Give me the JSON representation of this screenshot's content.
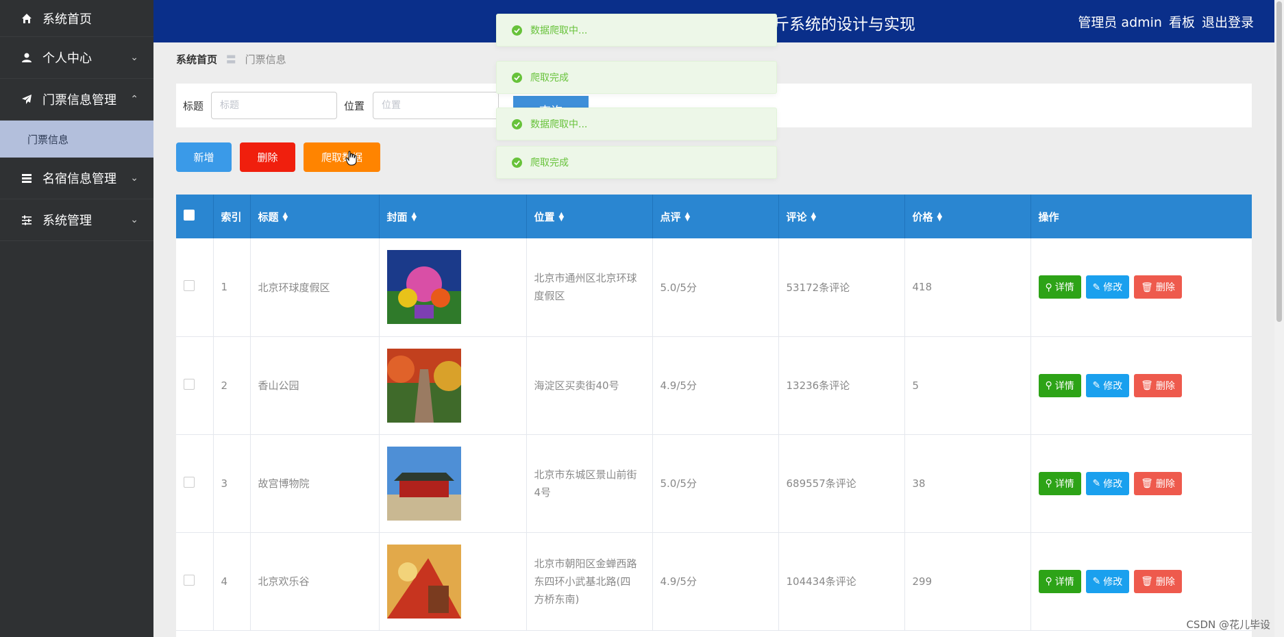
{
  "sidebar": {
    "items": [
      {
        "label": "系统首页",
        "icon": "home-icon"
      },
      {
        "label": "个人中心",
        "icon": "user-icon"
      },
      {
        "label": "门票信息管理",
        "icon": "paper-plane-icon"
      },
      {
        "label": "名宿信息管理",
        "icon": "list-icon"
      },
      {
        "label": "系统管理",
        "icon": "sliders-icon"
      }
    ],
    "submenu": {
      "label": "门票信息"
    }
  },
  "header": {
    "title": "斤系统的设计与实现",
    "user": "管理员 admin",
    "dashboard": "看板",
    "logout": "退出登录"
  },
  "breadcrumb": {
    "home": "系统首页",
    "separator": "〓",
    "current": "门票信息"
  },
  "search": {
    "title_label": "标题",
    "title_placeholder": "标题",
    "location_label": "位置",
    "location_placeholder": "位置",
    "query_label": "查询"
  },
  "actions": {
    "add": "新增",
    "delete": "删除",
    "crawl": "爬取数据"
  },
  "colors": {
    "add": "#3a9ae8",
    "delete": "#f01f0d",
    "crawl": "#ff8400",
    "header": "#0a2f8a",
    "table_header": "#2a86d1"
  },
  "table": {
    "headers": {
      "index": "索引",
      "title": "标题",
      "cover": "封面",
      "location": "位置",
      "rating": "点评",
      "reviews": "评论",
      "price": "价格",
      "ops": "操作"
    },
    "ops": {
      "detail": "详情",
      "edit": "修改",
      "delete": "删除"
    },
    "rows": [
      {
        "index": "1",
        "title": "北京环球度假区",
        "location": "北京市通州区北京环球度假区",
        "rating": "5.0/5分",
        "reviews": "53172条评论",
        "price": "418"
      },
      {
        "index": "2",
        "title": "香山公园",
        "location": "海淀区买卖街40号",
        "rating": "4.9/5分",
        "reviews": "13236条评论",
        "price": "5"
      },
      {
        "index": "3",
        "title": "故宫博物院",
        "location": "北京市东城区景山前街4号",
        "rating": "5.0/5分",
        "reviews": "689557条评论",
        "price": "38"
      },
      {
        "index": "4",
        "title": "北京欢乐谷",
        "location": "北京市朝阳区金蝉西路东四环小武基北路(四方桥东南)",
        "rating": "4.9/5分",
        "reviews": "104434条评论",
        "price": "299"
      }
    ]
  },
  "toasts": [
    {
      "text": "数据爬取中..."
    },
    {
      "text": "爬取完成"
    },
    {
      "text": "数据爬取中..."
    },
    {
      "text": "爬取完成"
    }
  ],
  "watermark": "CSDN @花儿毕设"
}
